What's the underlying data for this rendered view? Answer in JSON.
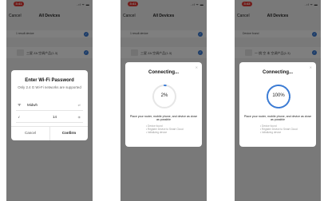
{
  "colors": {
    "accent": "#3a7bd5",
    "status_time": "#e53935",
    "overlay": "rgba(0,0,0,0.5)"
  },
  "statusbar": {
    "times": [
      "3:41",
      "3:41",
      "3:43"
    ],
    "indicators": "..ıl ᯤ ▬"
  },
  "nav": {
    "cancel": "Cancel",
    "title": "All Devices"
  },
  "list": {
    "section_labels": [
      "1 result device",
      "1 result device",
      "Device found"
    ],
    "device_names": [
      "三星 ZA 空调产品(1.3)",
      "三星 ZA 空调产品(1.3)",
      "一 桃 空 末 空调产品(1.3)"
    ]
  },
  "wifi_dialog": {
    "title": "Enter Wi-Fi Password",
    "subtitle": "Only 2.4 G Wi-Fi networks are supported",
    "ssid": "Midwh",
    "password": "14",
    "cancel": "Cancel",
    "confirm": "Confirm"
  },
  "connecting": [
    {
      "title": "Connecting...",
      "percent_label": "2%",
      "progress": 0.02
    },
    {
      "title": "Connecting...",
      "percent_label": "100%",
      "progress": 1.0
    }
  ],
  "connect_hint": "Place your router, mobile phone, and device as close as possible",
  "connect_steps": [
    "Device found",
    "Register Device to Smart Cloud",
    "Initializing device"
  ],
  "icons": [
    "wifi-icon",
    "lock-icon",
    "eye-icon",
    "swap-icon",
    "close-icon",
    "check-icon"
  ]
}
